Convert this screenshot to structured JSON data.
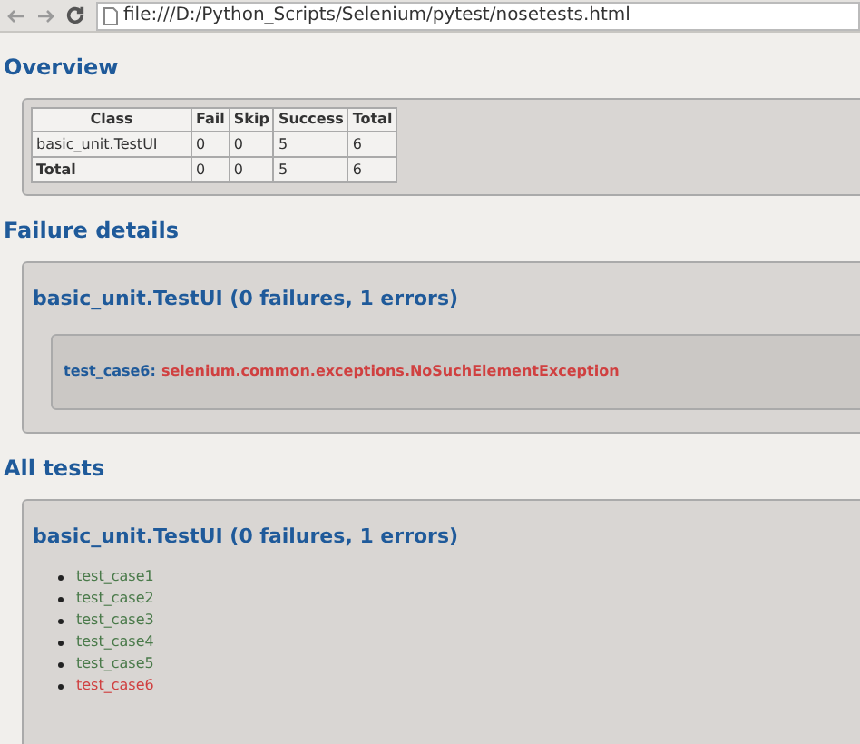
{
  "browser": {
    "address": "file:///D:/Python_Scripts/Selenium/pytest/nosetests.html"
  },
  "overview": {
    "heading": "Overview",
    "table": {
      "columns": [
        "Class",
        "Fail",
        "Skip",
        "Success",
        "Total"
      ],
      "rows": [
        {
          "kind": "class",
          "cells": [
            "basic_unit.TestUI",
            "0",
            "0",
            "5",
            "6"
          ]
        },
        {
          "kind": "total",
          "cells": [
            "Total",
            "0",
            "0",
            "5",
            "6"
          ]
        }
      ]
    }
  },
  "failure_details": {
    "heading": "Failure details",
    "title": "basic_unit.TestUI (0 failures, 1 errors)",
    "failures": [
      {
        "test": "test_case6:",
        "error": "selenium.common.exceptions.NoSuchElementException"
      }
    ]
  },
  "all_tests": {
    "heading": "All tests",
    "title": "basic_unit.TestUI (0 failures, 1 errors)",
    "tests": [
      {
        "name": "test_case1",
        "kind": "passed"
      },
      {
        "name": "test_case2",
        "kind": "passed"
      },
      {
        "name": "test_case3",
        "kind": "passed"
      },
      {
        "name": "test_case4",
        "kind": "passed"
      },
      {
        "name": "test_case5",
        "kind": "passed"
      },
      {
        "name": "test_case6",
        "kind": "error"
      }
    ]
  }
}
